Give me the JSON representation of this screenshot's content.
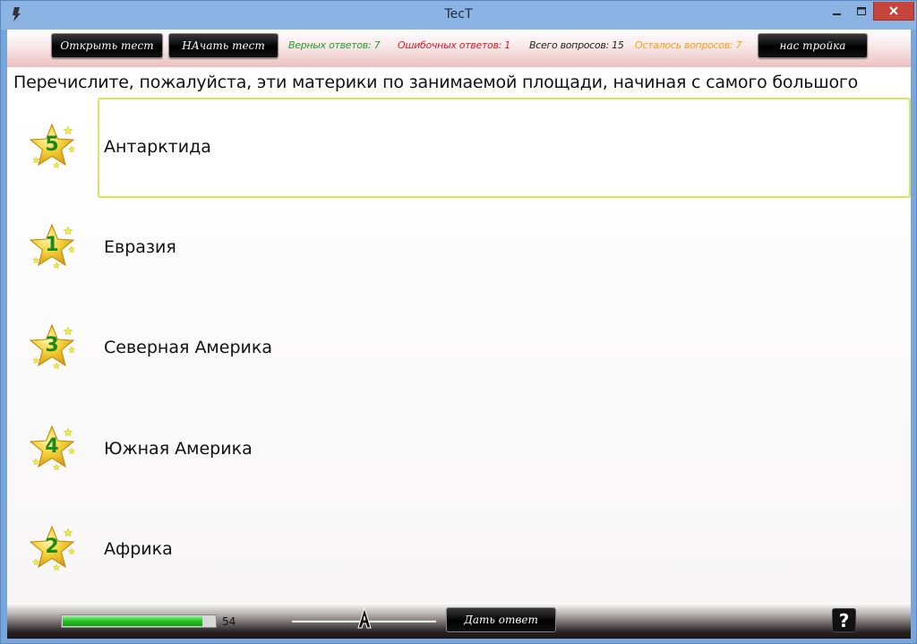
{
  "window": {
    "title": "TecT"
  },
  "toolbar": {
    "open_label": "Открыть тест",
    "start_label": "НАчать тест",
    "settings_label": "нас тройка",
    "stats": {
      "correct": "Верных ответов: 7",
      "wrong": "Ошибочных ответов: 1",
      "total": "Всего вопросов: 15",
      "remaining": "Осталось вопросов: 7"
    }
  },
  "question": {
    "text": "Перечислите, пожалуйста, эти материки по занимаемой площади, начиная с самого большого"
  },
  "answers": [
    {
      "number": "5",
      "text": "Антарктида",
      "selected": true
    },
    {
      "number": "1",
      "text": "Евразия",
      "selected": false
    },
    {
      "number": "3",
      "text": "Северная Америка",
      "selected": false
    },
    {
      "number": "4",
      "text": "Южная Америка",
      "selected": false
    },
    {
      "number": "2",
      "text": "Африка",
      "selected": false
    }
  ],
  "footer": {
    "progress_value": "54",
    "progress_percent": 92,
    "submit_label": "Дать ответ",
    "help_label": "?"
  },
  "colors": {
    "correct": "#2a9a2a",
    "wrong": "#d4202a",
    "remaining": "#f0a020",
    "selected_border": "#d8e65a",
    "star_number": "#1a8a1a"
  },
  "icons": [
    "app-icon",
    "minimize-icon",
    "maximize-icon",
    "close-icon",
    "star-icon",
    "slider-thumb-icon",
    "help-icon"
  ]
}
